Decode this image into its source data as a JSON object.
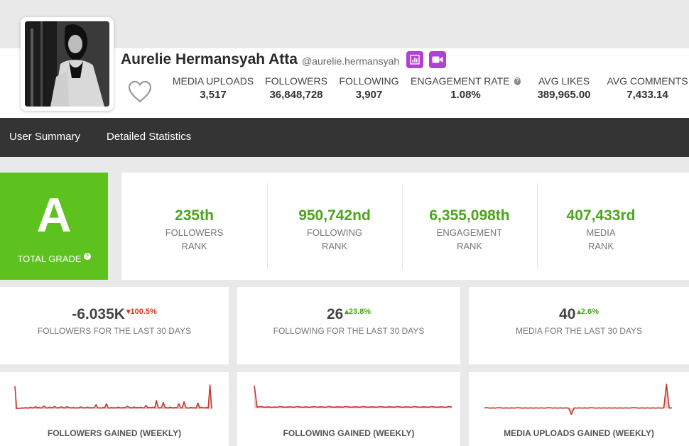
{
  "profile": {
    "name": "Aurelie Hermansyah Atta",
    "handle": "@aurelie.hermansyah",
    "icons": [
      "avatar-photo",
      "heart-icon",
      "bar-chart-icon",
      "video-camera-icon"
    ],
    "accent_color": "#b43fd6"
  },
  "stats": [
    {
      "label": "MEDIA UPLOADS",
      "value": "3,517"
    },
    {
      "label": "FOLLOWERS",
      "value": "36,848,728"
    },
    {
      "label": "FOLLOWING",
      "value": "3,907"
    },
    {
      "label": "ENGAGEMENT RATE",
      "value": "1.08%"
    },
    {
      "label": "AVG LIKES",
      "value": "389,965.00"
    },
    {
      "label": "AVG COMMENTS",
      "value": "7,433.14"
    }
  ],
  "tabs": [
    "User Summary",
    "Detailed Statistics"
  ],
  "grade": {
    "letter": "A",
    "label": "TOTAL GRADE",
    "color": "#5dc21e"
  },
  "ranks": [
    {
      "value": "235th",
      "label": "FOLLOWERS",
      "sub": "RANK"
    },
    {
      "value": "950,742nd",
      "label": "FOLLOWING",
      "sub": "RANK"
    },
    {
      "value": "6,355,098th",
      "label": "ENGAGEMENT",
      "sub": "RANK"
    },
    {
      "value": "407,433rd",
      "label": "MEDIA",
      "sub": "RANK"
    }
  ],
  "changes": [
    {
      "value": "-6.035K",
      "pct": "100.5%",
      "direction": "down",
      "label": "FOLLOWERS FOR THE LAST 30 DAYS"
    },
    {
      "value": "26",
      "pct": "23.8%",
      "direction": "up",
      "label": "FOLLOWING FOR THE LAST 30 DAYS"
    },
    {
      "value": "40",
      "pct": "2.6%",
      "direction": "up",
      "label": "MEDIA FOR THE LAST 30 DAYS"
    }
  ],
  "colors": {
    "negative": "#d0391f",
    "positive": "#4aa51d",
    "nav_bg": "#343434",
    "graph_line": "#c0392b"
  },
  "graphs": [
    {
      "label": "FOLLOWERS GAINED (WEEKLY)",
      "values": [
        0.95,
        0.02,
        0.04,
        0.03,
        0.05,
        0.04,
        0.06,
        0.05,
        0.04,
        0.08,
        0.05,
        0.06,
        0.1,
        0.05,
        0.07,
        0.04,
        0.08,
        0.12,
        0.06,
        0.05,
        0.08,
        0.05,
        0.07,
        0.11,
        0.06,
        0.05,
        0.07,
        0.09,
        0.06,
        0.05,
        0.1,
        0.08,
        0.06,
        0.05,
        0.07,
        0.04,
        0.06,
        0.05,
        0.09,
        0.07,
        0.05,
        0.06,
        0.08,
        0.05,
        0.06,
        0.05,
        0.07,
        0.18,
        0.05,
        0.06,
        0.04,
        0.07,
        0.05,
        0.22,
        0.06,
        0.04,
        0.07,
        0.05,
        0.06,
        0.05,
        0.08,
        0.06,
        0.05,
        0.07,
        0.05,
        0.12,
        0.08,
        0.06,
        0.05,
        0.09,
        0.05,
        0.07,
        0.06,
        0.08,
        0.05,
        0.06,
        0.15,
        0.05,
        0.07,
        0.06,
        0.08,
        0.05,
        0.35,
        0.06,
        0.05,
        0.07,
        0.28,
        0.05,
        0.06,
        0.05,
        0.08,
        0.06,
        0.05,
        0.07,
        0.05,
        0.22,
        0.05,
        0.06,
        0.3,
        0.08,
        0.04,
        0.05,
        0.07,
        0.05,
        0.06,
        0.04,
        0.25,
        0.05,
        0.08,
        0.06,
        0.05,
        0.07,
        0.04,
        1.0,
        0.02
      ]
    },
    {
      "label": "FOLLOWING GAINED (WEEKLY)",
      "values": [
        1.0,
        0.05,
        0.08,
        0.06,
        0.05,
        0.07,
        0.04,
        0.06,
        0.05,
        0.08,
        0.06,
        0.05,
        0.07,
        0.06,
        0.05,
        0.08,
        0.06,
        0.05,
        0.07,
        0.05,
        0.06,
        0.08,
        0.05,
        0.07,
        0.06,
        0.05,
        0.08,
        0.06,
        0.05,
        0.07,
        0.06,
        0.05,
        0.08,
        0.06,
        0.05,
        0.07,
        0.06,
        0.05,
        0.08,
        0.06,
        0.05,
        0.07,
        0.06,
        0.05,
        0.08,
        0.06,
        0.05,
        0.07,
        0.06,
        0.05,
        0.08,
        0.06,
        0.05,
        0.07,
        0.06,
        0.05,
        0.08,
        0.06,
        0.05,
        0.07,
        0.06,
        0.05,
        0.08,
        0.06,
        0.05,
        0.07,
        0.06,
        0.05,
        0.08,
        0.06
      ]
    },
    {
      "label": "MEDIA UPLOADS GAINED (WEEKLY)",
      "values": [
        0.02,
        0.03,
        0.01,
        0.02,
        0.01,
        0.03,
        0.02,
        0.01,
        0.02,
        0.01,
        0.02,
        0.01,
        0.03,
        0.02,
        0.01,
        0.02,
        0.01,
        0.02,
        0.01,
        0.02,
        0.01,
        0.02,
        0.01,
        0.02,
        0.03,
        0.01,
        0.02,
        0.01,
        0.02,
        0.01,
        0.02,
        0.01,
        -0.25,
        0.02,
        0.01,
        0.02,
        0.01,
        0.02,
        0.01,
        0.03,
        0.02,
        0.01,
        0.02,
        0.01,
        0.02,
        0.01,
        0.02,
        0.01,
        0.02,
        0.01,
        0.02,
        0.01,
        0.02,
        0.01,
        0.02,
        0.03,
        0.02,
        0.01,
        0.02,
        0.01,
        0.02,
        0.01,
        0.02,
        0.01,
        0.02,
        0.01,
        0.02,
        1.0,
        0.01,
        0.02
      ]
    }
  ]
}
